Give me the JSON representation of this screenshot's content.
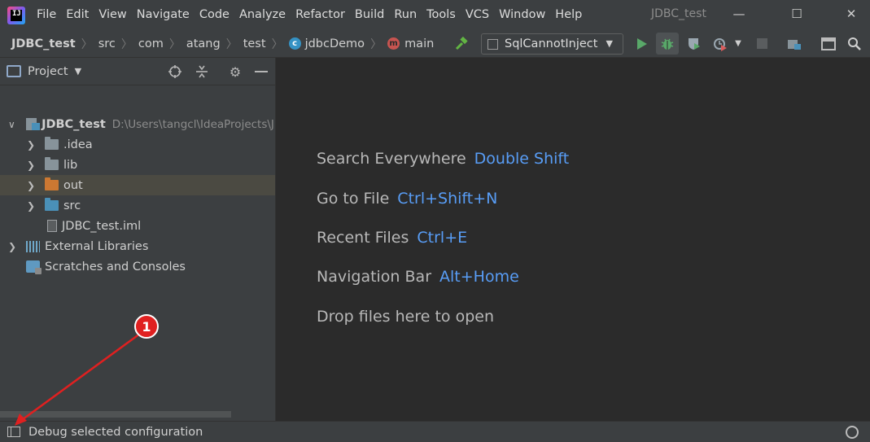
{
  "app": {
    "window_title": "JDBC_test",
    "menu": [
      "File",
      "Edit",
      "View",
      "Navigate",
      "Code",
      "Analyze",
      "Refactor",
      "Build",
      "Run",
      "Tools",
      "VCS",
      "Window",
      "Help"
    ]
  },
  "breadcrumbs": [
    "JDBC_test",
    "src",
    "com",
    "atang",
    "test",
    "jdbcDemo",
    "main"
  ],
  "toolbar": {
    "run_config": "SqlCannotInject",
    "icons": [
      "hammer-icon",
      "run-icon",
      "debug-icon",
      "coverage-icon",
      "profile-icon",
      "stop-icon",
      "project-structure-icon",
      "layout-icon",
      "search-icon"
    ]
  },
  "project_panel": {
    "title": "Project",
    "tree": [
      {
        "label": "JDBC_test",
        "path": "D:\\Users\\tangcl\\IdeaProjects\\JDBC_test",
        "icon": "module-icon"
      },
      {
        "label": ".idea",
        "icon": "folder-icon"
      },
      {
        "label": "lib",
        "icon": "folder-icon"
      },
      {
        "label": "out",
        "icon": "folder-orange-icon"
      },
      {
        "label": "src",
        "icon": "folder-blue-icon"
      },
      {
        "label": "JDBC_test.iml",
        "icon": "file-icon"
      },
      {
        "label": "External Libraries",
        "icon": "library-icon"
      },
      {
        "label": "Scratches and Consoles",
        "icon": "scratch-icon"
      }
    ]
  },
  "editor": {
    "hints": [
      {
        "label": "Search Everywhere",
        "key": "Double Shift"
      },
      {
        "label": "Go to File",
        "key": "Ctrl+Shift+N"
      },
      {
        "label": "Recent Files",
        "key": "Ctrl+E"
      },
      {
        "label": "Navigation Bar",
        "key": "Alt+Home"
      },
      {
        "label": "Drop files here to open",
        "key": ""
      }
    ]
  },
  "status": {
    "text": "Debug selected configuration"
  },
  "annotation": {
    "marker": "1",
    "color": "#e02020"
  }
}
